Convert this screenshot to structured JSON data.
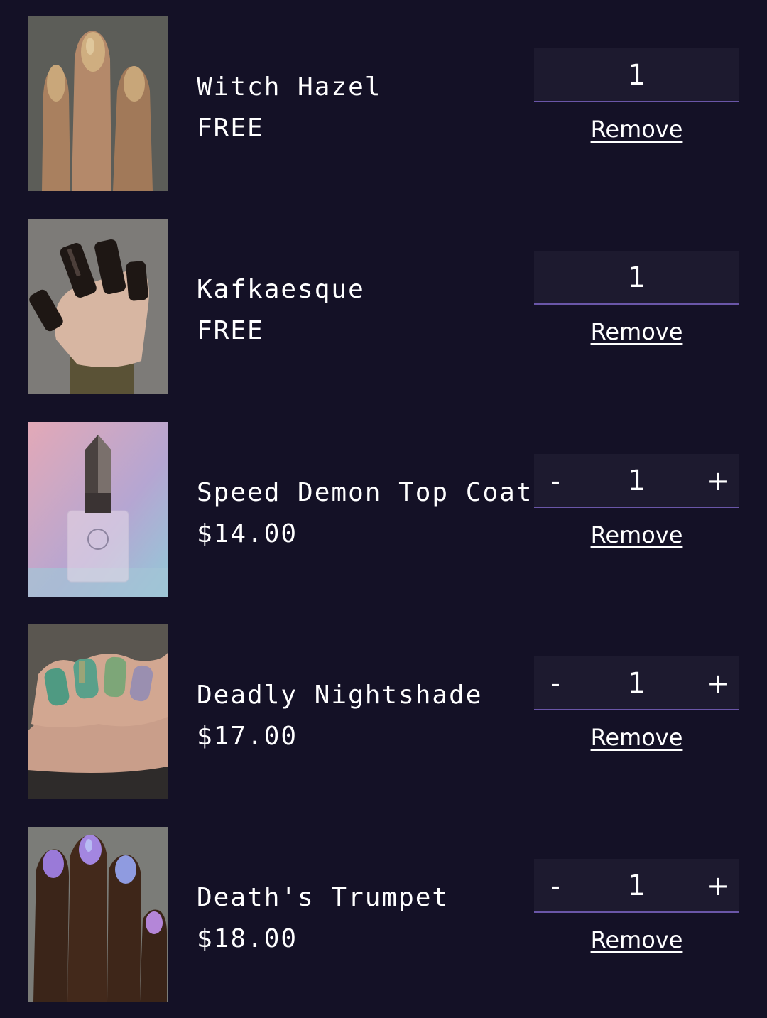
{
  "colors": {
    "background": "#141126",
    "qty_box": "#1d1a2f",
    "qty_underline": "#6a56a8",
    "text": "#ffffff"
  },
  "cart": {
    "items": [
      {
        "name": "Witch Hazel",
        "price": "FREE",
        "quantity": "1",
        "remove_label": "Remove",
        "has_stepper": false
      },
      {
        "name": "Kafkaesque",
        "price": "FREE",
        "quantity": "1",
        "remove_label": "Remove",
        "has_stepper": false
      },
      {
        "name": "Speed Demon Top Coat",
        "price": "$14.00",
        "quantity": "1",
        "remove_label": "Remove",
        "has_stepper": true,
        "minus_label": "-",
        "plus_label": "+"
      },
      {
        "name": "Deadly Nightshade",
        "price": "$17.00",
        "quantity": "1",
        "remove_label": "Remove",
        "has_stepper": true,
        "minus_label": "-",
        "plus_label": "+"
      },
      {
        "name": "Death's Trumpet",
        "price": "$18.00",
        "quantity": "1",
        "remove_label": "Remove",
        "has_stepper": true,
        "minus_label": "-",
        "plus_label": "+"
      }
    ]
  }
}
